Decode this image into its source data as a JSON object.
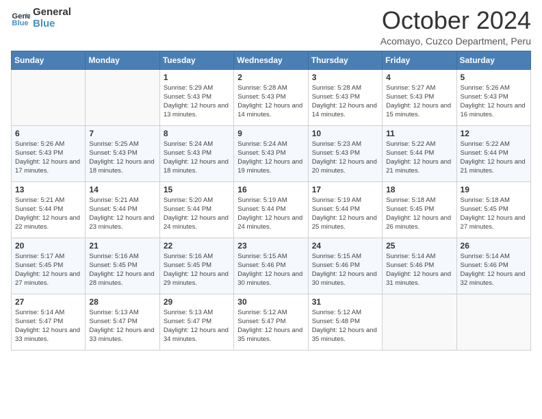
{
  "header": {
    "logo_line1": "General",
    "logo_line2": "Blue",
    "month": "October 2024",
    "subtitle": "Acomayo, Cuzco Department, Peru"
  },
  "weekdays": [
    "Sunday",
    "Monday",
    "Tuesday",
    "Wednesday",
    "Thursday",
    "Friday",
    "Saturday"
  ],
  "weeks": [
    [
      {
        "day": "",
        "info": ""
      },
      {
        "day": "",
        "info": ""
      },
      {
        "day": "1",
        "info": "Sunrise: 5:29 AM\nSunset: 5:43 PM\nDaylight: 12 hours and 13 minutes."
      },
      {
        "day": "2",
        "info": "Sunrise: 5:28 AM\nSunset: 5:43 PM\nDaylight: 12 hours and 14 minutes."
      },
      {
        "day": "3",
        "info": "Sunrise: 5:28 AM\nSunset: 5:43 PM\nDaylight: 12 hours and 14 minutes."
      },
      {
        "day": "4",
        "info": "Sunrise: 5:27 AM\nSunset: 5:43 PM\nDaylight: 12 hours and 15 minutes."
      },
      {
        "day": "5",
        "info": "Sunrise: 5:26 AM\nSunset: 5:43 PM\nDaylight: 12 hours and 16 minutes."
      }
    ],
    [
      {
        "day": "6",
        "info": "Sunrise: 5:26 AM\nSunset: 5:43 PM\nDaylight: 12 hours and 17 minutes."
      },
      {
        "day": "7",
        "info": "Sunrise: 5:25 AM\nSunset: 5:43 PM\nDaylight: 12 hours and 18 minutes."
      },
      {
        "day": "8",
        "info": "Sunrise: 5:24 AM\nSunset: 5:43 PM\nDaylight: 12 hours and 18 minutes."
      },
      {
        "day": "9",
        "info": "Sunrise: 5:24 AM\nSunset: 5:43 PM\nDaylight: 12 hours and 19 minutes."
      },
      {
        "day": "10",
        "info": "Sunrise: 5:23 AM\nSunset: 5:43 PM\nDaylight: 12 hours and 20 minutes."
      },
      {
        "day": "11",
        "info": "Sunrise: 5:22 AM\nSunset: 5:44 PM\nDaylight: 12 hours and 21 minutes."
      },
      {
        "day": "12",
        "info": "Sunrise: 5:22 AM\nSunset: 5:44 PM\nDaylight: 12 hours and 21 minutes."
      }
    ],
    [
      {
        "day": "13",
        "info": "Sunrise: 5:21 AM\nSunset: 5:44 PM\nDaylight: 12 hours and 22 minutes."
      },
      {
        "day": "14",
        "info": "Sunrise: 5:21 AM\nSunset: 5:44 PM\nDaylight: 12 hours and 23 minutes."
      },
      {
        "day": "15",
        "info": "Sunrise: 5:20 AM\nSunset: 5:44 PM\nDaylight: 12 hours and 24 minutes."
      },
      {
        "day": "16",
        "info": "Sunrise: 5:19 AM\nSunset: 5:44 PM\nDaylight: 12 hours and 24 minutes."
      },
      {
        "day": "17",
        "info": "Sunrise: 5:19 AM\nSunset: 5:44 PM\nDaylight: 12 hours and 25 minutes."
      },
      {
        "day": "18",
        "info": "Sunrise: 5:18 AM\nSunset: 5:45 PM\nDaylight: 12 hours and 26 minutes."
      },
      {
        "day": "19",
        "info": "Sunrise: 5:18 AM\nSunset: 5:45 PM\nDaylight: 12 hours and 27 minutes."
      }
    ],
    [
      {
        "day": "20",
        "info": "Sunrise: 5:17 AM\nSunset: 5:45 PM\nDaylight: 12 hours and 27 minutes."
      },
      {
        "day": "21",
        "info": "Sunrise: 5:16 AM\nSunset: 5:45 PM\nDaylight: 12 hours and 28 minutes."
      },
      {
        "day": "22",
        "info": "Sunrise: 5:16 AM\nSunset: 5:45 PM\nDaylight: 12 hours and 29 minutes."
      },
      {
        "day": "23",
        "info": "Sunrise: 5:15 AM\nSunset: 5:46 PM\nDaylight: 12 hours and 30 minutes."
      },
      {
        "day": "24",
        "info": "Sunrise: 5:15 AM\nSunset: 5:46 PM\nDaylight: 12 hours and 30 minutes."
      },
      {
        "day": "25",
        "info": "Sunrise: 5:14 AM\nSunset: 5:46 PM\nDaylight: 12 hours and 31 minutes."
      },
      {
        "day": "26",
        "info": "Sunrise: 5:14 AM\nSunset: 5:46 PM\nDaylight: 12 hours and 32 minutes."
      }
    ],
    [
      {
        "day": "27",
        "info": "Sunrise: 5:14 AM\nSunset: 5:47 PM\nDaylight: 12 hours and 33 minutes."
      },
      {
        "day": "28",
        "info": "Sunrise: 5:13 AM\nSunset: 5:47 PM\nDaylight: 12 hours and 33 minutes."
      },
      {
        "day": "29",
        "info": "Sunrise: 5:13 AM\nSunset: 5:47 PM\nDaylight: 12 hours and 34 minutes."
      },
      {
        "day": "30",
        "info": "Sunrise: 5:12 AM\nSunset: 5:47 PM\nDaylight: 12 hours and 35 minutes."
      },
      {
        "day": "31",
        "info": "Sunrise: 5:12 AM\nSunset: 5:48 PM\nDaylight: 12 hours and 35 minutes."
      },
      {
        "day": "",
        "info": ""
      },
      {
        "day": "",
        "info": ""
      }
    ]
  ]
}
